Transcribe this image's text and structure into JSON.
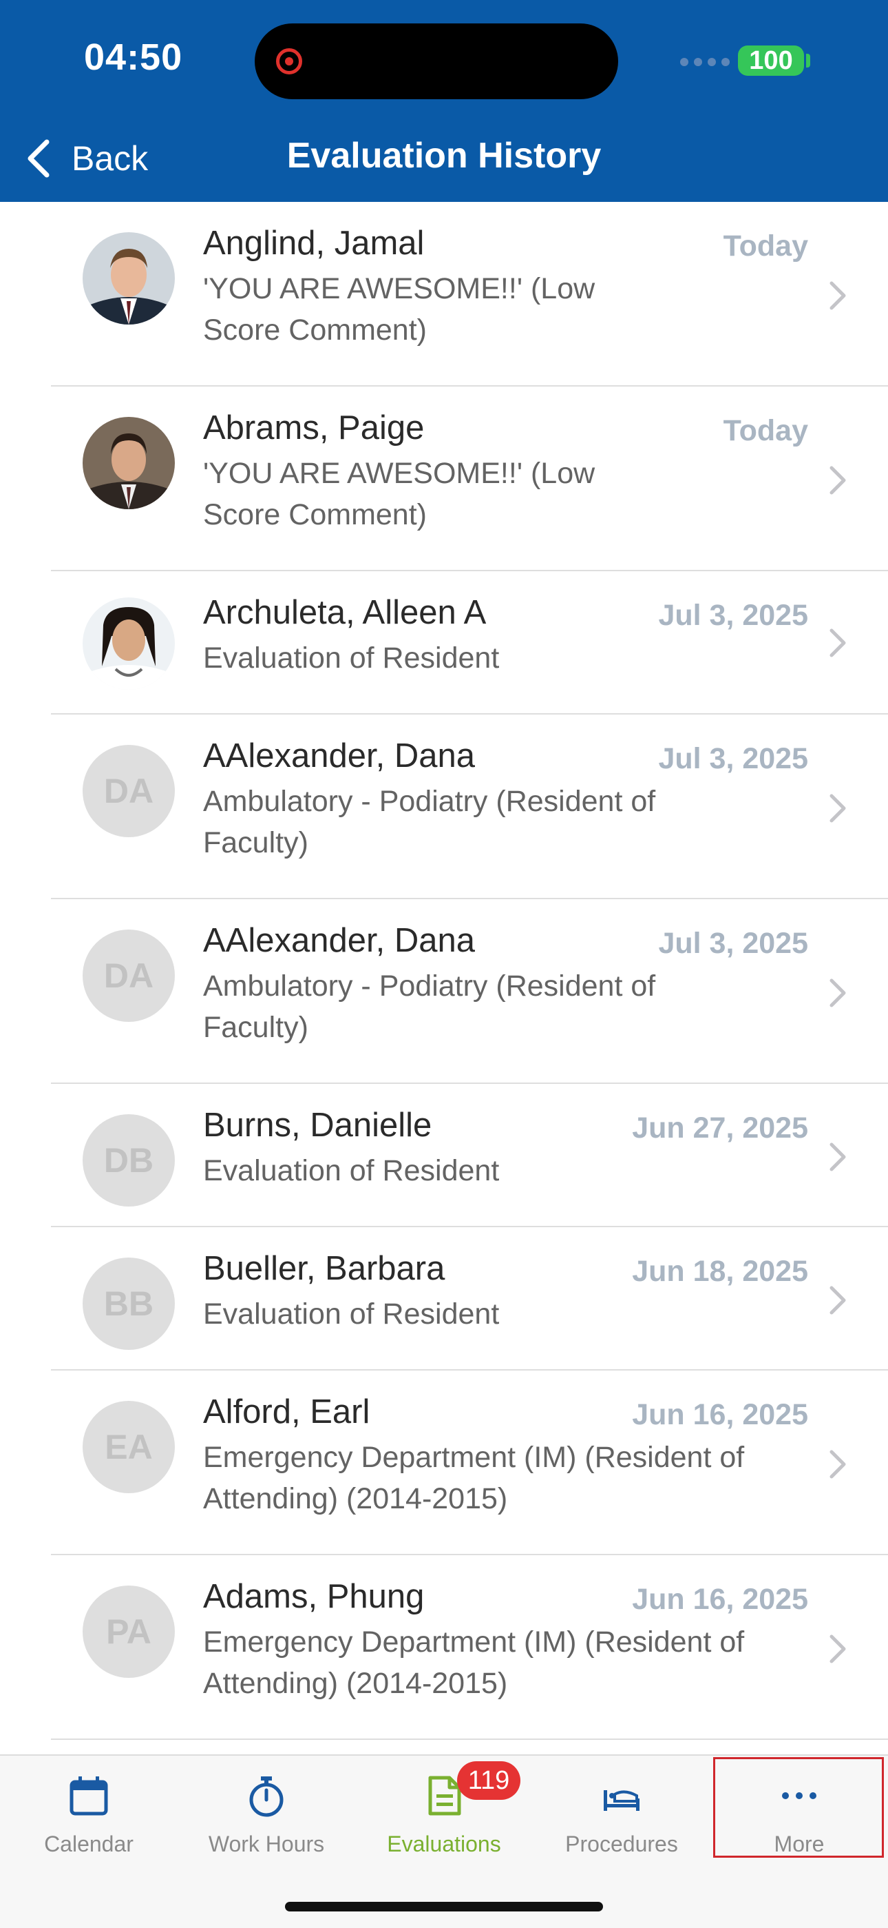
{
  "status_bar": {
    "time": "04:50",
    "battery": "100"
  },
  "header": {
    "back_label": "Back",
    "title": "Evaluation History"
  },
  "rows": [
    {
      "name": "Anglind, Jamal",
      "subtitle": "'YOU ARE AWESOME!!'  (Low Score Comment)",
      "date": "Today",
      "avatar_type": "photo",
      "initials": ""
    },
    {
      "name": "Abrams, Paige",
      "subtitle": "'YOU ARE AWESOME!!'  (Low Score Comment)",
      "date": "Today",
      "avatar_type": "photo",
      "initials": ""
    },
    {
      "name": "Archuleta, Alleen A",
      "subtitle": "Evaluation of Resident",
      "date": "Jul 3, 2025",
      "avatar_type": "photo",
      "initials": ""
    },
    {
      "name": "AAlexander, Dana",
      "subtitle": "Ambulatory - Podiatry (Resident of Faculty)",
      "date": "Jul 3, 2025",
      "avatar_type": "initials",
      "initials": "DA"
    },
    {
      "name": "AAlexander, Dana",
      "subtitle": "Ambulatory - Podiatry (Resident of Faculty)",
      "date": "Jul 3, 2025",
      "avatar_type": "initials",
      "initials": "DA"
    },
    {
      "name": "Burns, Danielle",
      "subtitle": "Evaluation of Resident",
      "date": "Jun 27, 2025",
      "avatar_type": "initials",
      "initials": "DB"
    },
    {
      "name": "Bueller, Barbara",
      "subtitle": "Evaluation of Resident",
      "date": "Jun 18, 2025",
      "avatar_type": "initials",
      "initials": "BB"
    },
    {
      "name": "Alford, Earl",
      "subtitle": "Emergency Department (IM) (Resident of Attending) (2014-2015)",
      "date": "Jun 16, 2025",
      "avatar_type": "initials",
      "initials": "EA"
    },
    {
      "name": "Adams, Phung",
      "subtitle": "Emergency Department (IM) (Resident of Attending) (2014-2015)",
      "date": "Jun 16, 2025",
      "avatar_type": "initials",
      "initials": "PA"
    }
  ],
  "tabbar": {
    "tabs": [
      {
        "label": "Calendar",
        "icon": "calendar-icon"
      },
      {
        "label": "Work Hours",
        "icon": "stopwatch-icon"
      },
      {
        "label": "Evaluations",
        "icon": "document-icon",
        "active": true
      },
      {
        "label": "Procedures",
        "icon": "bed-icon"
      },
      {
        "label": "More",
        "icon": "more-icon"
      }
    ],
    "evaluations_badge": "119"
  },
  "colors": {
    "header_bg": "#0a5aa7",
    "active_tab": "#7ab030",
    "inactive_tab": "#8a8a8a",
    "date_text": "#a9b5c2",
    "badge": "#e53333",
    "highlight_box": "#d0272c"
  }
}
